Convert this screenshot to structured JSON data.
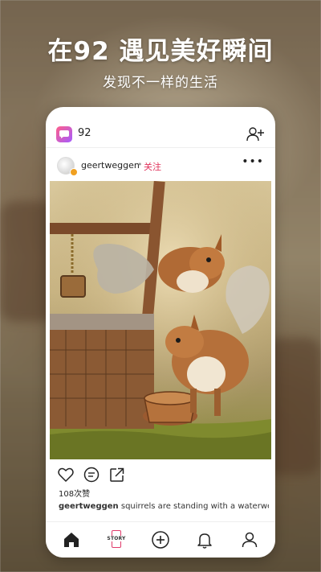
{
  "promo": {
    "headline": "在92 遇见美好瞬间",
    "subheadline": "发现不一样的生活"
  },
  "app": {
    "name": "92"
  },
  "post": {
    "username": "geertweggen",
    "separator": "•",
    "follow_label": "关注",
    "more_label": "•••",
    "likes_text": "108次赞",
    "caption_user": "geertweggen",
    "caption_text": " squirrels are standing with a waterwell."
  },
  "tabbar": {
    "story_label": "STORY"
  },
  "colors": {
    "accent": "#e0305a",
    "logo_gradient_start": "#ff5f8a",
    "logo_gradient_end": "#a45cff"
  },
  "icons": {
    "header": [
      "app-logo-icon",
      "add-user-icon",
      "more-icon"
    ],
    "actions": [
      "heart-icon",
      "comment-icon",
      "share-icon"
    ],
    "tabs": [
      "home-icon",
      "story-icon",
      "plus-icon",
      "bell-icon",
      "profile-icon"
    ]
  }
}
